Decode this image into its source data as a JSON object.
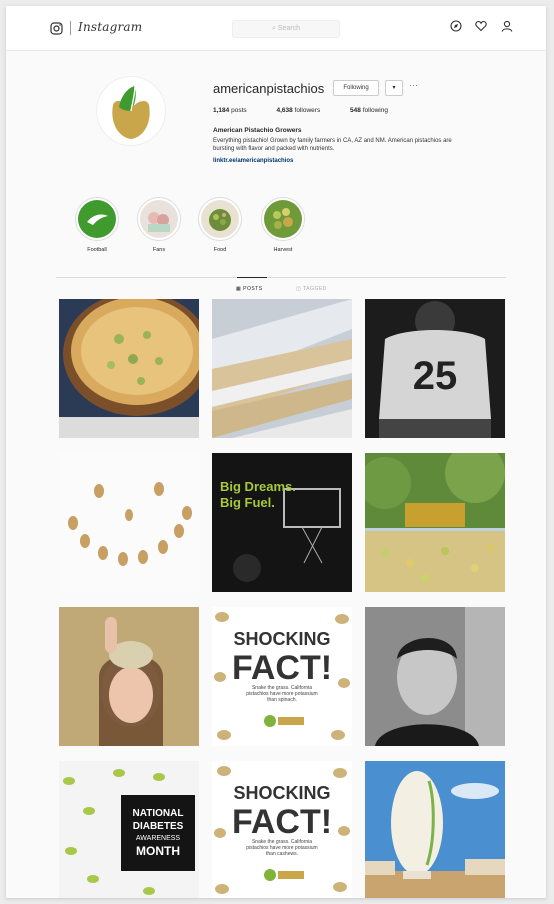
{
  "nav": {
    "logo": "Instagram",
    "search_placeholder": "Search",
    "icons": [
      "camera-icon",
      "compass-icon",
      "heart-icon",
      "profile-icon"
    ]
  },
  "profile": {
    "username": "americanpistachios",
    "follow_label": "Following",
    "dropdown_label": "▾",
    "more_label": "···",
    "posts_count": "1,184",
    "posts_label": "posts",
    "followers_count": "4,638",
    "followers_label": "followers",
    "following_count": "548",
    "following_label": "following",
    "full_name": "American Pistachio Growers",
    "bio": "Everything pistachio! Grown by family farmers in CA, AZ and NM. American pistachios are bursting with flavor and packed with nutrients.",
    "link": "linktr.ee/americanpistachios"
  },
  "highlights": [
    {
      "label": "Football"
    },
    {
      "label": "Fans"
    },
    {
      "label": "Food"
    },
    {
      "label": "Harvest"
    }
  ],
  "tabs": [
    {
      "label": "POSTS"
    },
    {
      "label": "TAGGED"
    }
  ],
  "posts": {
    "tile4": {
      "text1": "Big Dreams.",
      "text2": "Big Fuel."
    },
    "tile7": {
      "line1": "SHOCKING",
      "line2": "FACT!",
      "caption": "Snake the grass. California pistachios have more potassium than spinach."
    },
    "tile9": {
      "line1": "NATIONAL",
      "line2": "DIABETES",
      "line3": "AWARENESS",
      "line4": "MONTH"
    },
    "tile10": {
      "line1": "SHOCKING",
      "line2": "FACT!",
      "caption": "Snake the grass. California pistachios have more potassium than cashews."
    },
    "jersey_number": "25"
  },
  "colors": {
    "brand_green": "#3f9b2e",
    "brand_gold": "#c9a64a",
    "link_blue": "#00376b"
  }
}
